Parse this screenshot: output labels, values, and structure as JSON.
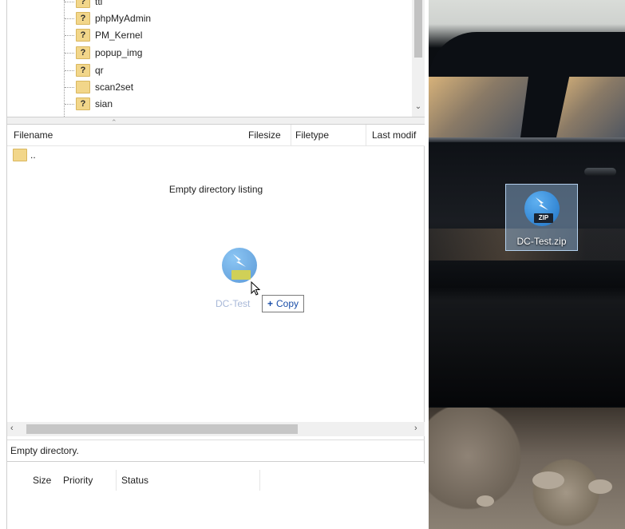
{
  "tree": {
    "items": [
      {
        "label": "ttl",
        "icon": "question-folder-icon"
      },
      {
        "label": "phpMyAdmin",
        "icon": "question-folder-icon"
      },
      {
        "label": "PM_Kernel",
        "icon": "question-folder-icon"
      },
      {
        "label": "popup_img",
        "icon": "question-folder-icon"
      },
      {
        "label": "qr",
        "icon": "question-folder-icon"
      },
      {
        "label": "scan2set",
        "icon": "folder-icon"
      },
      {
        "label": "sian",
        "icon": "question-folder-icon"
      }
    ]
  },
  "list": {
    "columns": {
      "filename": "Filename",
      "filesize": "Filesize",
      "filetype": "Filetype",
      "last_modified": "Last modif"
    },
    "parent_dir": "..",
    "empty_message": "Empty directory listing"
  },
  "drag": {
    "ghost_label": "DC-Test",
    "tooltip": "Copy",
    "tooltip_icon": "plus"
  },
  "status": {
    "text": "Empty directory."
  },
  "queue": {
    "columns": {
      "size": "Size",
      "priority": "Priority",
      "status": "Status"
    }
  },
  "desktop": {
    "icon_label": "DC-Test.zip",
    "icon_badge": "ZIP"
  }
}
